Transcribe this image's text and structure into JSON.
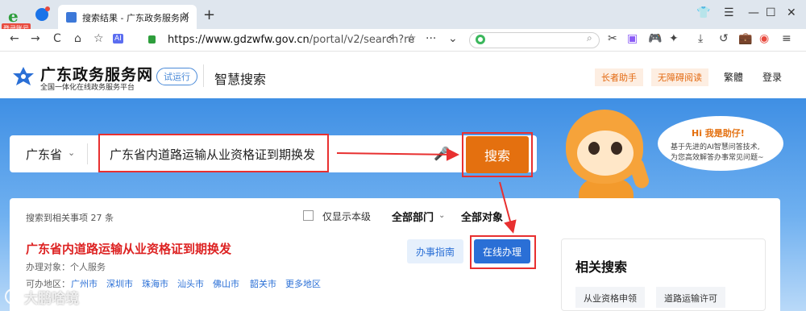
{
  "browser": {
    "login_badge": "登录账号",
    "ie_logo": "e",
    "tab_title": "搜索结果 - 广东政务服务网",
    "tab_close": "×",
    "new_tab": "+",
    "win_controls": [
      "👕",
      "☰",
      "—",
      "☐",
      "✕"
    ],
    "nav_buttons": [
      "←",
      "→",
      "C",
      "⌂",
      "☆"
    ],
    "ai_badge": "AI",
    "url_host": "https://www.gdzwfw.gov.cn",
    "url_path": "/portal/v2/search?re",
    "url_actions": [
      "⚡",
      "☆",
      "···",
      "⌄"
    ],
    "side_search_placeholder": "",
    "toolbar_icons": [
      "✂",
      "▣",
      "🎮",
      "✦",
      "⤓",
      "↺",
      "💼",
      "◉",
      "≡"
    ]
  },
  "header": {
    "brand": "广东政务服务网",
    "brand_sub": "全国一体化在线政务服务平台",
    "trial": "试运行",
    "smart_search": "智慧搜索",
    "elder_helper": "长者助手",
    "accessible_read": "无障碍阅读",
    "traditional": "繁體",
    "login": "登录"
  },
  "search": {
    "province": "广东省",
    "query": "广东省内道路运输从业资格证到期换发",
    "button": "搜索"
  },
  "mascot": {
    "greeting": "Hi 我是助仔!",
    "line1": "基于先进的AI智慧问答技术,",
    "line2": "为您高效解答办事常见问题~"
  },
  "results": {
    "count": "搜索到相关事项 27 条",
    "only_local": "仅显示本级",
    "all_departments": "全部部门",
    "all_targets": "全部对象",
    "item": {
      "title": "广东省内道路运输从业资格证到期换发",
      "target": "办理对象：个人服务",
      "area_label": "可办地区：",
      "cities": [
        "广州市",
        "深圳市",
        "珠海市",
        "汕头市",
        "佛山市",
        "韶关市",
        "更多地区"
      ],
      "guide_button": "办事指南",
      "online_button": "在线办理"
    },
    "related_title": "相关搜索",
    "related_tags": [
      "从业资格申领",
      "道路运输许可"
    ]
  },
  "watermark": "大鹏啥境",
  "colors": {
    "accent_orange": "#e4700f",
    "primary_blue": "#2a6fd6",
    "annotation_red": "#e83030",
    "result_title_red": "#dd2222"
  }
}
